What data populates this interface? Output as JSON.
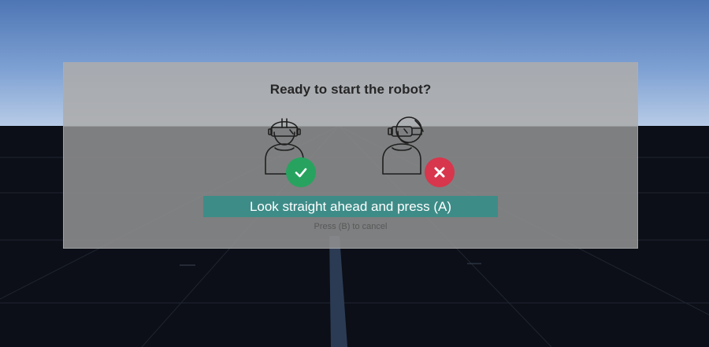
{
  "dialog": {
    "title": "Ready to start the robot?",
    "action_label": "Look straight ahead and press (A)",
    "cancel_label": "Press (B) to cancel",
    "correct_pose_icon": "headset-forward-icon",
    "wrong_pose_icon": "headset-turned-icon",
    "check_icon": "check-icon",
    "cross_icon": "cross-icon"
  },
  "colors": {
    "sky_top": "#4e76b4",
    "sky_bottom": "#b7cbe6",
    "ground": "#0c0f17",
    "panel": "#929292",
    "action_bar": "#3e8c88",
    "ok": "#27a35f",
    "error": "#d7364c",
    "title_text": "#262626",
    "hint_text": "#585858"
  }
}
